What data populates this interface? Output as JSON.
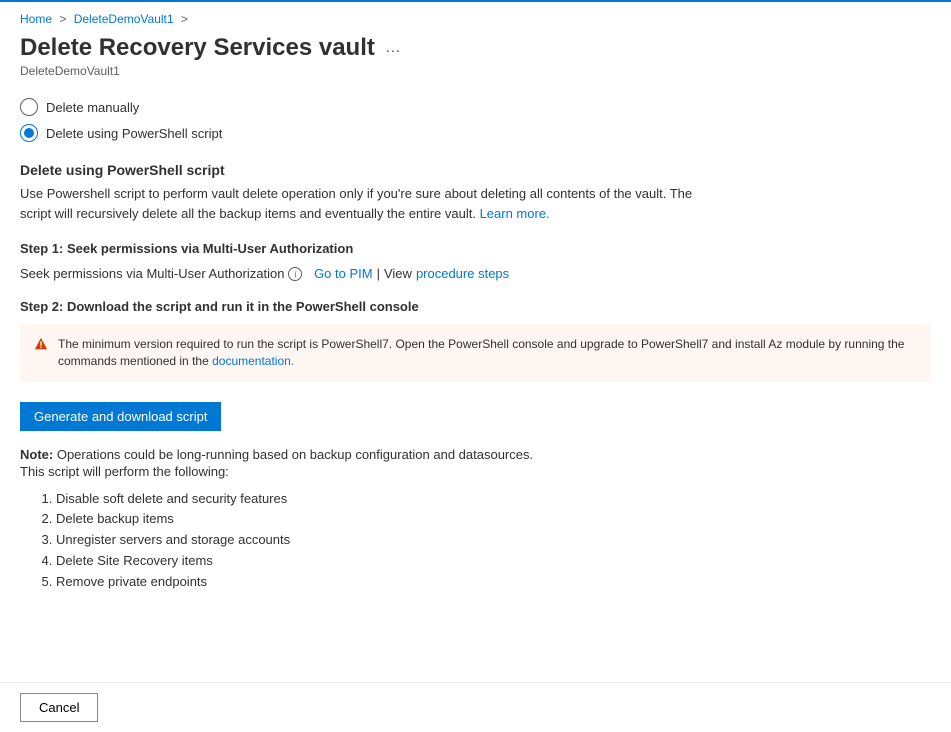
{
  "breadcrumb": {
    "home": "Home",
    "vault": "DeleteDemoVault1"
  },
  "header": {
    "title": "Delete Recovery Services vault",
    "subtitle": "DeleteDemoVault1"
  },
  "radio": {
    "manual": "Delete manually",
    "script": "Delete using PowerShell script"
  },
  "section": {
    "heading": "Delete using PowerShell script",
    "description": "Use Powershell script to perform vault delete operation only if you're sure about deleting all contents of the vault. The script will recursively delete all the backup items and eventually the entire vault. ",
    "learn_more": "Learn more."
  },
  "step1": {
    "heading": "Step 1: Seek permissions via Multi-User Authorization",
    "text": "Seek permissions via Multi-User Authorization",
    "pim_link": "Go to PIM",
    "view_label": "View",
    "procedure_link": "procedure steps"
  },
  "step2": {
    "heading": "Step 2: Download the script and run it in the PowerShell console"
  },
  "warning": {
    "text": "The minimum version required to run the script is PowerShell7. Open the PowerShell console and upgrade to PowerShell7 and install Az module by running the commands mentioned in the ",
    "doc_link": "documentation."
  },
  "generate_button": "Generate and download script",
  "note": {
    "label": "Note:",
    "text": " Operations could be long-running based on backup configuration and datasources.",
    "following": "This script will perform the following:"
  },
  "steps_list": [
    "Disable soft delete and security features",
    "Delete backup items",
    "Unregister servers and storage accounts",
    "Delete Site Recovery items",
    "Remove private endpoints"
  ],
  "footer": {
    "cancel": "Cancel"
  }
}
